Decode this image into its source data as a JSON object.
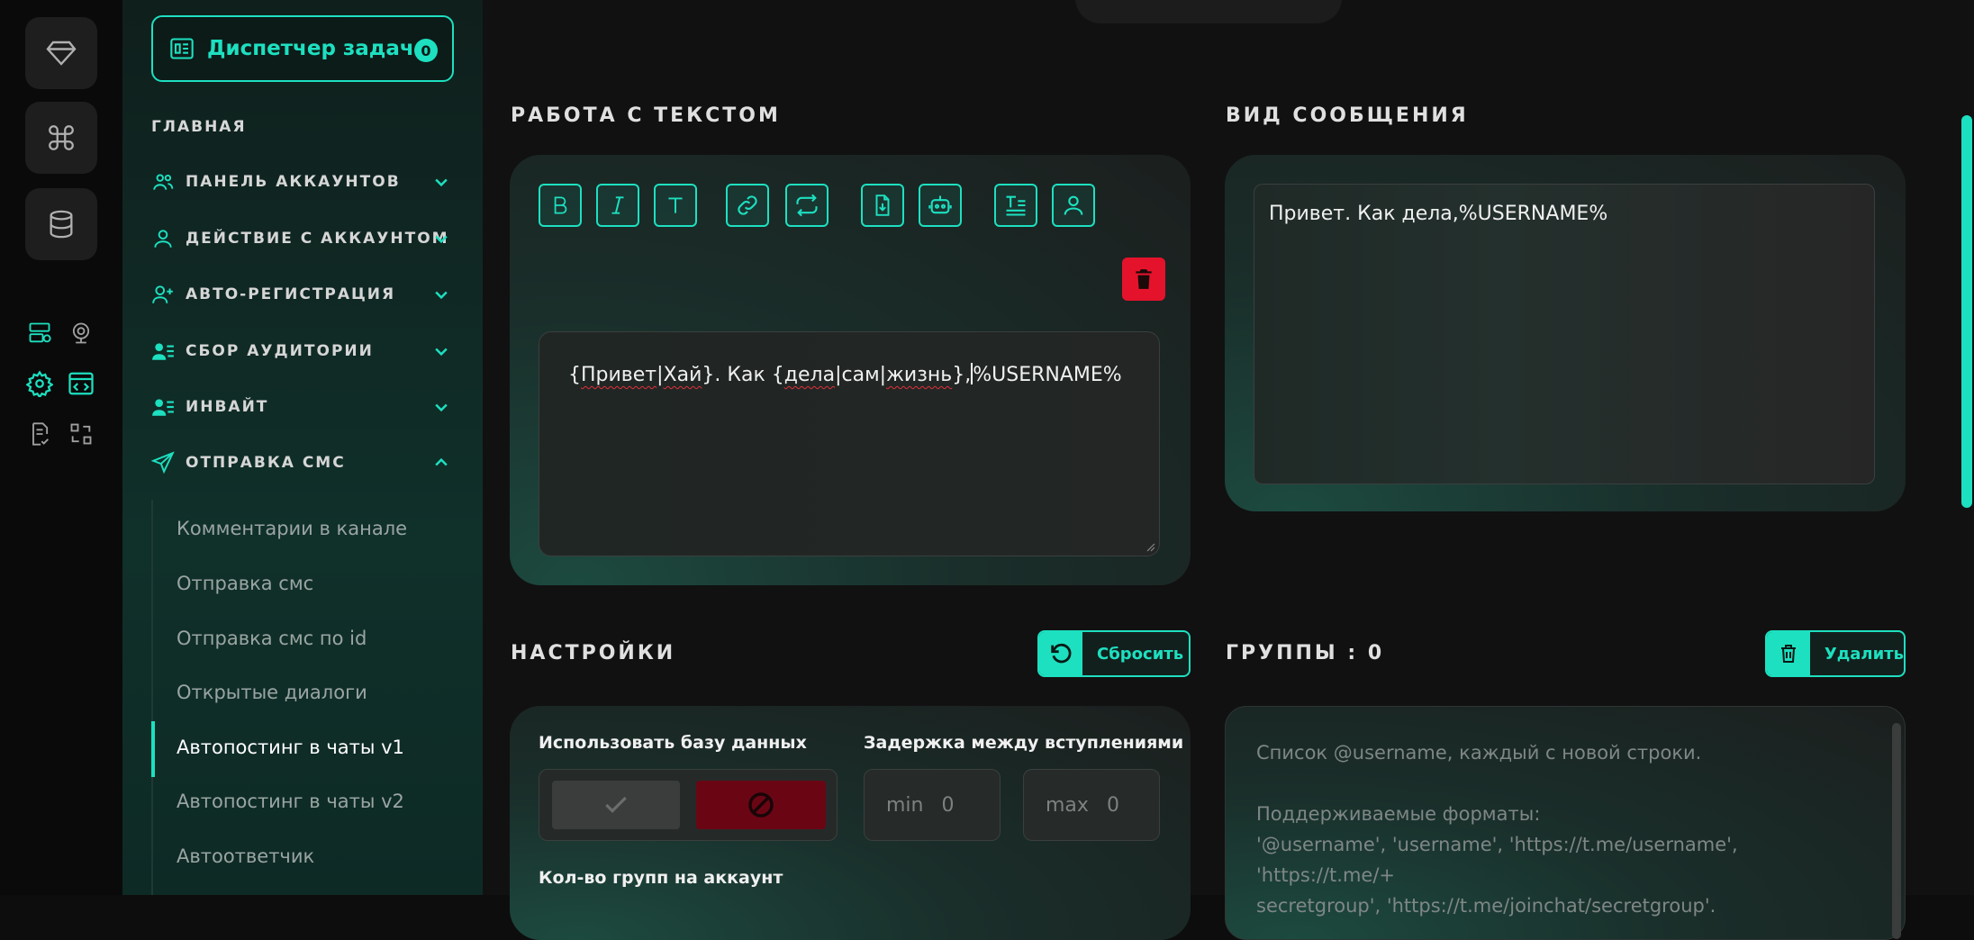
{
  "sidebar": {
    "task_manager": {
      "label": "Диспетчер задач",
      "count": "0"
    },
    "heading": "ГЛАВНАЯ",
    "sections": [
      {
        "label": "ПАНЕЛЬ АККАУНТОВ",
        "icon": "users-icon",
        "expanded": false
      },
      {
        "label": "ДЕЙСТВИЕ С АККАУНТОМ",
        "icon": "user-icon",
        "expanded": false
      },
      {
        "label": "АВТО-РЕГИСТРАЦИЯ",
        "icon": "user-plus-icon",
        "expanded": false
      },
      {
        "label": "СБОР АУДИТОРИИ",
        "icon": "user-list-icon",
        "expanded": false
      },
      {
        "label": "ИНВАЙТ",
        "icon": "user-list-icon",
        "expanded": false
      },
      {
        "label": "ОТПРАВКА СМС",
        "icon": "send-icon",
        "expanded": true
      }
    ],
    "sub_items": [
      "Комментарии в канале",
      "Отправка смс",
      "Отправка смс по id",
      "Открытые диалоги",
      "Автопостинг в чаты v1",
      "Автопостинг в чаты v2",
      "Автоответчик"
    ],
    "active_sub_item": "Автопостинг в чаты v1"
  },
  "text_section": {
    "title": "РАБОТА С ТЕКСТОМ",
    "editor_text": {
      "open1": "{",
      "w1": "Привет",
      "sep1": "|",
      "w2": "Хай",
      "mid": "}. Как {",
      "w3": "дела",
      "sep2": "|сам|",
      "w4": "жизнь",
      "end": "},",
      "cursor_after": "%USERNAME%"
    },
    "tools": [
      "bold-icon",
      "italic-icon",
      "text-icon",
      "link-icon",
      "repeat-icon",
      "file-import-icon",
      "robot-icon",
      "text-format-icon",
      "user-icon"
    ]
  },
  "preview_section": {
    "title": "ВИД СООБЩЕНИЯ",
    "text": "Привет. Как дела,%USERNAME%"
  },
  "settings": {
    "title": "НАСТРОЙКИ",
    "reset_label": "Сбросить",
    "use_db_label": "Использовать базу данных",
    "delay_label": "Задержка между вступлениями",
    "min_placeholder": "min",
    "min_value": "0",
    "max_placeholder": "max",
    "max_value": "0",
    "groups_per_account_label": "Кол-во групп на аккаунт"
  },
  "groups": {
    "title": "ГРУППЫ : 0",
    "delete_label": "Удалить",
    "placeholder_line1": "Список @username, каждый с новой строки.",
    "placeholder_line2": "Поддерживаемые форматы:",
    "placeholder_line3": "'@username', 'username', 'https://t.me/username', 'https://t.me/+",
    "placeholder_line4": "secretgroup', 'https://t.me/joinchat/secretgroup'."
  },
  "colors": {
    "accent": "#1de0c0",
    "danger": "#e4132b"
  }
}
